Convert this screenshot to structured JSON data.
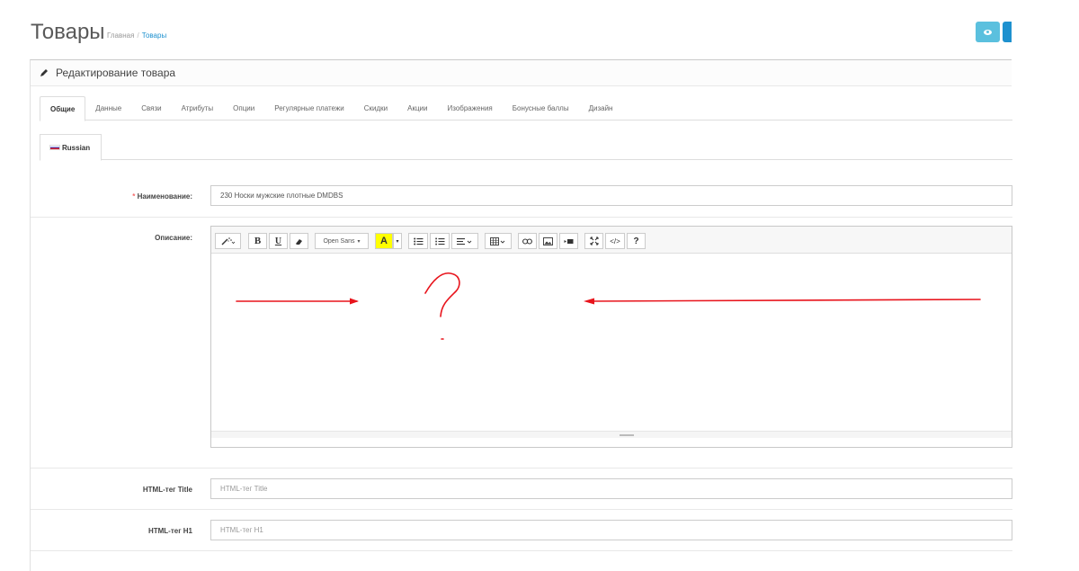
{
  "header": {
    "title": "Товары",
    "breadcrumb": [
      {
        "label": "Главная"
      },
      {
        "label": "Товары"
      }
    ],
    "view_button_icon": "eye-icon"
  },
  "panel": {
    "heading_icon": "pencil-icon",
    "heading": "Редактирование товара"
  },
  "tabs": [
    {
      "label": "Общие",
      "active": true
    },
    {
      "label": "Данные"
    },
    {
      "label": "Связи"
    },
    {
      "label": "Атрибуты"
    },
    {
      "label": "Опции"
    },
    {
      "label": "Регулярные платежи"
    },
    {
      "label": "Скидки"
    },
    {
      "label": "Акции"
    },
    {
      "label": "Изображения"
    },
    {
      "label": "Бонусные баллы"
    },
    {
      "label": "Дизайн"
    }
  ],
  "language_tab": {
    "label": "Russian",
    "icon": "russian-flag-icon"
  },
  "form": {
    "name": {
      "required_mark": "*",
      "label": "Наименование:",
      "value": "230 Носки мужские плотные DMDBS"
    },
    "description": {
      "label": "Описание:"
    },
    "meta_title": {
      "label": "HTML-тег Title",
      "placeholder": "HTML-тег Title",
      "value": ""
    },
    "h1": {
      "label": "HTML-тег H1",
      "placeholder": "HTML-тег H1",
      "value": ""
    }
  },
  "editor_toolbar": {
    "font_name": "Open Sans",
    "icons": [
      "magic-wand-icon",
      "bold-icon",
      "underline-icon",
      "eraser-icon",
      "font-dropdown",
      "text-color-icon",
      "color-dropdown-caret-icon",
      "unordered-list-icon",
      "ordered-list-icon",
      "paragraph-align-icon",
      "table-icon",
      "link-icon",
      "image-icon",
      "video-icon",
      "fullscreen-icon",
      "code-view-icon",
      "help-icon"
    ],
    "bold": "B",
    "underline": "U",
    "text_color": "A",
    "code_view": "</>",
    "help": "?"
  },
  "annotation": {
    "color": "#e8141c",
    "shapes": [
      "right-arrow",
      "question-mark",
      "left-arrow"
    ]
  },
  "colors": {
    "accent_blue": "#1e91cf",
    "info_cyan": "#5bc0de",
    "required_red": "#f56b6b",
    "highlight_yellow": "#ffff00"
  }
}
